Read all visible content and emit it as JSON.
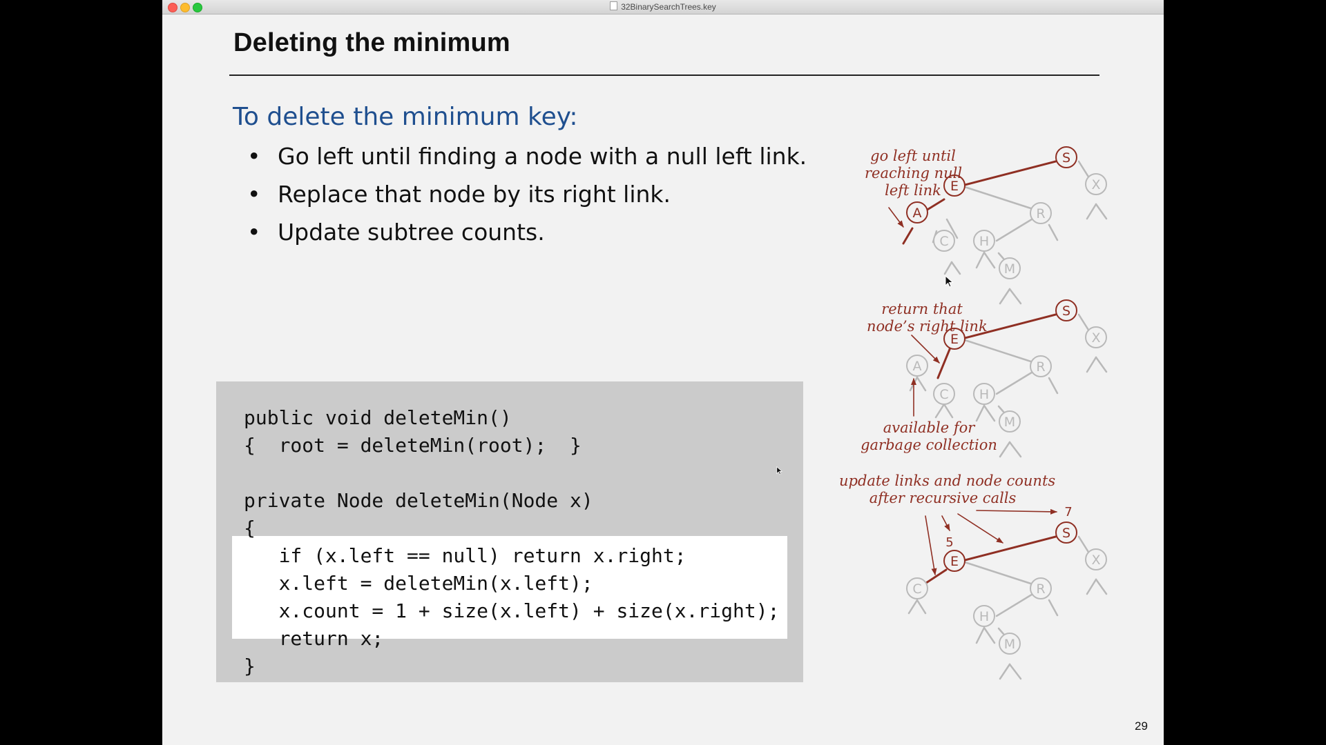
{
  "window": {
    "title": "32BinarySearchTrees.key"
  },
  "slide": {
    "title": "Deleting the minimum",
    "intro": "To delete the minimum key:",
    "bullet_symbol": "•",
    "bullets": [
      "Go left until finding a node with a null left link.",
      "Replace that node by its right link.",
      "Update subtree counts."
    ],
    "code": [
      "public void deleteMin()",
      "{  root = deleteMin(root);  }",
      "",
      "private Node deleteMin(Node x)",
      "{",
      "   if (x.left == null) return x.right;",
      "   x.left = deleteMin(x.left);",
      "   x.count = 1 + size(x.left) + size(x.right);",
      "   return x;",
      "}"
    ],
    "annotations": {
      "tree1": [
        "go left until",
        "reaching null",
        "left link"
      ],
      "tree2_top": [
        "return that",
        "node’s right link"
      ],
      "tree2_bottom": [
        "available for",
        "garbage collection"
      ],
      "tree3": [
        "update links and node counts",
        "after recursive calls"
      ]
    },
    "count_labels": {
      "e_count": "5",
      "s_count": "7"
    },
    "tree_keys": [
      "S",
      "E",
      "X",
      "A",
      "R",
      "C",
      "H",
      "M"
    ],
    "page_number": "29"
  },
  "colors": {
    "accent_red": "#8f2f23",
    "intro_blue": "#1f4f8f",
    "gray_node": "#b9b9b9",
    "code_background": "#cbcbcb",
    "code_highlight": "#ffffff"
  }
}
